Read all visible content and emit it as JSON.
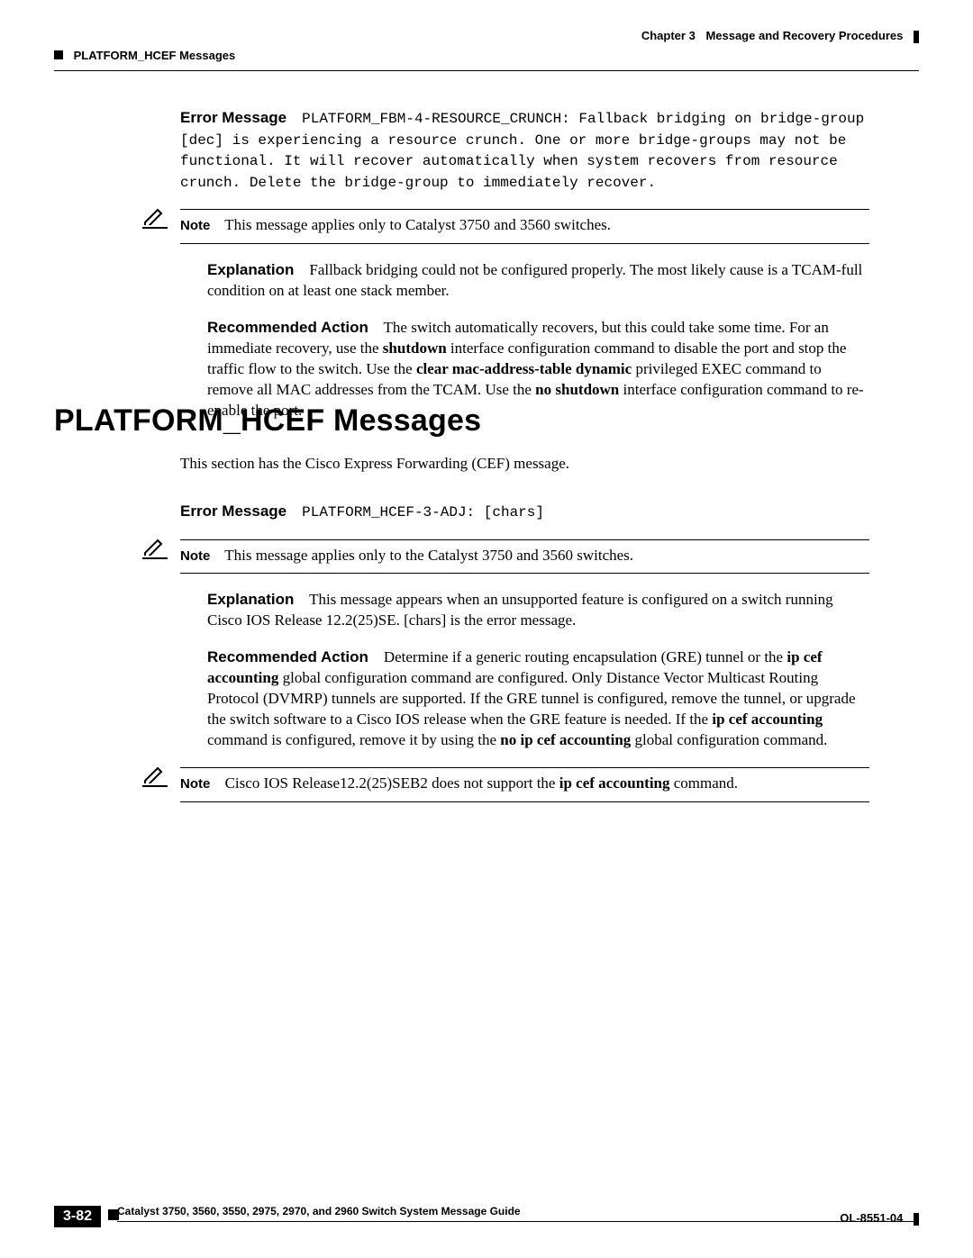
{
  "header": {
    "chapter": "Chapter 3",
    "chapter_title": "Message and Recovery Procedures",
    "section": "PLATFORM_HCEF Messages"
  },
  "block1": {
    "error_label": "Error Message",
    "error_code": "PLATFORM_FBM-4-RESOURCE_CRUNCH: Fallback bridging on bridge-group [dec] is experiencing a resource crunch. One or more bridge-groups may not be functional. It will recover automatically when system recovers from resource crunch. Delete the bridge-group to immediately recover.",
    "note_label": "Note",
    "note_text": "This message applies only to Catalyst 3750 and 3560 switches.",
    "explanation_label": "Explanation",
    "explanation_text": "Fallback bridging could not be configured properly. The most likely cause is a TCAM-full condition on at least one stack member.",
    "action_label": "Recommended Action",
    "action_pre": "The switch automatically recovers, but this could take some time. For an immediate recovery, use the ",
    "action_b1": "shutdown",
    "action_mid1": " interface configuration command to disable the port and stop the traffic flow to the switch. Use the ",
    "action_b2": "clear mac-address-table dynamic",
    "action_mid2": " privileged EXEC command to remove all MAC addresses from the TCAM. Use the ",
    "action_b3": "no shutdown",
    "action_post": " interface configuration command to re-enable the port."
  },
  "heading": "PLATFORM_HCEF Messages",
  "intro": "This section has the Cisco Express Forwarding (CEF) message.",
  "block2": {
    "error_label": "Error Message",
    "error_code": "PLATFORM_HCEF-3-ADJ: [chars]",
    "note1_label": "Note",
    "note1_text": "This message applies only to the Catalyst 3750 and 3560 switches.",
    "explanation_label": "Explanation",
    "explanation_text": "This message appears when an unsupported feature is configured on a switch running Cisco IOS Release 12.2(25)SE. [chars] is the error message.",
    "action_label": "Recommended Action",
    "action_pre": "Determine if a generic routing encapsulation (GRE) tunnel or the ",
    "action_b1": "ip cef accounting",
    "action_mid1": " global configuration command are configured. Only Distance Vector Multicast Routing Protocol (DVMRP) tunnels are supported. If the GRE tunnel is configured, remove the tunnel, or upgrade the switch software to a Cisco IOS release when the GRE feature is needed. If the ",
    "action_b2": "ip cef accounting",
    "action_mid2": " command is configured, remove it by using the ",
    "action_b3": "no ip cef accounting",
    "action_post": " global configuration command.",
    "note2_label": "Note",
    "note2_pre": "Cisco IOS Release12.2(25)SEB2 does not support the ",
    "note2_b": "ip cef accounting",
    "note2_post": " command."
  },
  "footer": {
    "title": "Catalyst 3750, 3560, 3550, 2975, 2970, and 2960 Switch System Message Guide",
    "page": "3-82",
    "doc_id": "OL-8551-04"
  }
}
